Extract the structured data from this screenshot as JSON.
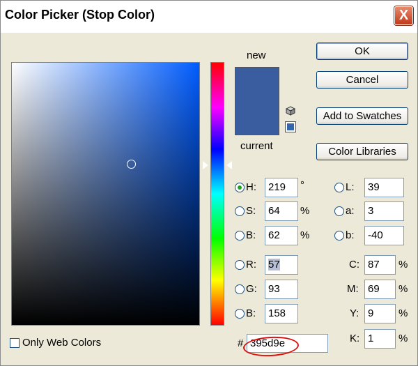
{
  "window": {
    "title": "Color Picker (Stop Color)",
    "close_glyph": "X"
  },
  "preview": {
    "new_label": "new",
    "current_label": "current",
    "new_color": "#395d9e",
    "current_color": "#395d9e"
  },
  "buttons": {
    "ok": "OK",
    "cancel": "Cancel",
    "add_to_swatches": "Add to Swatches",
    "color_libraries": "Color Libraries"
  },
  "hsb": {
    "h_label": "H:",
    "h_value": "219",
    "h_unit": "°",
    "s_label": "S:",
    "s_value": "64",
    "s_unit": "%",
    "b_label": "B:",
    "b_value": "62",
    "b_unit": "%"
  },
  "rgb": {
    "r_label": "R:",
    "r_value": "57",
    "g_label": "G:",
    "g_value": "93",
    "b_label": "B:",
    "b_value": "158"
  },
  "lab": {
    "l_label": "L:",
    "l_value": "39",
    "a_label": "a:",
    "a_value": "3",
    "b_label": "b:",
    "b_value": "-40"
  },
  "cmyk": {
    "c_label": "C:",
    "c_value": "87",
    "c_unit": "%",
    "m_label": "M:",
    "m_value": "69",
    "m_unit": "%",
    "y_label": "Y:",
    "y_value": "9",
    "y_unit": "%",
    "k_label": "K:",
    "k_value": "1",
    "k_unit": "%"
  },
  "hex": {
    "label": "#",
    "value": "395d9e"
  },
  "options": {
    "only_web_colors": "Only Web Colors",
    "only_web_colors_checked": false
  },
  "selected_mode": "H"
}
